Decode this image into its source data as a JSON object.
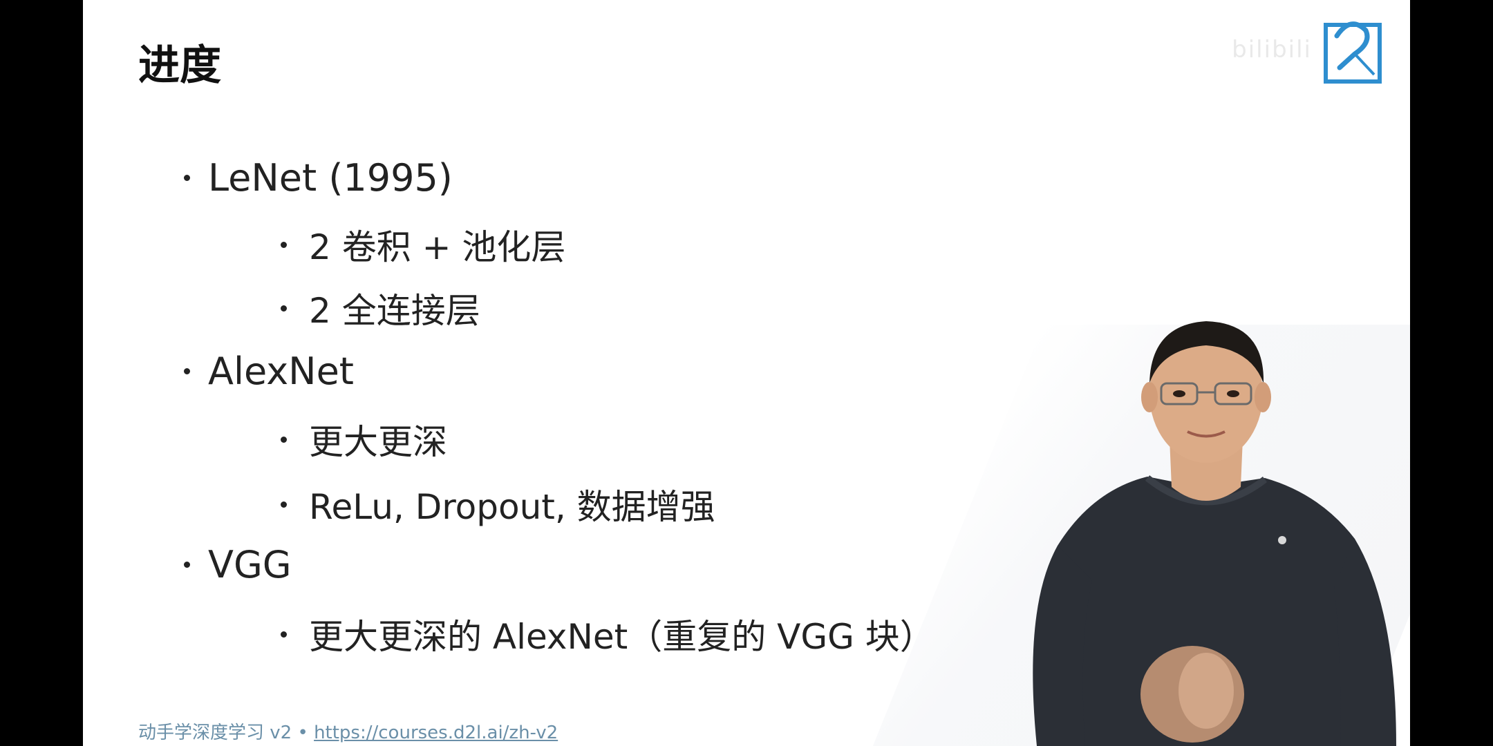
{
  "slide": {
    "title": "进度",
    "items": [
      {
        "level": 1,
        "text": "LeNet (1995)"
      },
      {
        "level": 2,
        "text": "2 卷积 + 池化层"
      },
      {
        "level": 2,
        "text": "2 全连接层"
      },
      {
        "level": 1,
        "text": "AlexNet"
      },
      {
        "level": 2,
        "text": "更大更深"
      },
      {
        "level": 2,
        "text": "ReLu, Dropout, 数据增强"
      },
      {
        "level": 1,
        "text": "VGG"
      },
      {
        "level": 2,
        "text": "更大更深的 AlexNet（重复的 VGG 块）"
      }
    ],
    "footer": {
      "prefix": "动手学深度学习 v2 • ",
      "link": "https://courses.d2l.ai/zh-v2"
    }
  },
  "watermark": {
    "text": "bilibili",
    "icon": "bilibili-logo-icon"
  },
  "colors": {
    "background": "#ffffff",
    "letterbox": "#000000",
    "text": "#222222",
    "footer": "#6a8fa8",
    "logo_accent": "#2e8ecf"
  }
}
